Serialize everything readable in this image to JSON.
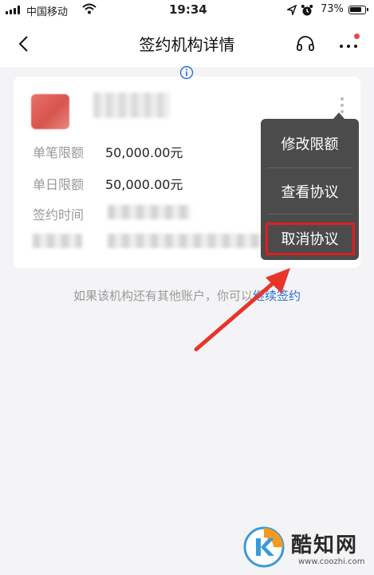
{
  "status_bar": {
    "carrier": "中国移动",
    "time": "19:34",
    "battery": "73%",
    "battery_level": 0.73,
    "icons": [
      "signal-icon",
      "wifi-icon",
      "location-icon",
      "alarm-icon",
      "battery-icon"
    ]
  },
  "nav": {
    "title": "签约机构详情",
    "icons": [
      "back-icon",
      "headset-icon",
      "more-icon"
    ],
    "badge_color": "#f04848"
  },
  "card": {
    "rows": [
      {
        "label": "单笔限额",
        "value": "50,000.00元"
      },
      {
        "label": "单日限额",
        "value": "50,000.00元"
      },
      {
        "label": "签约时间",
        "value": ""
      }
    ]
  },
  "menu": {
    "items": [
      {
        "label": "修改限额"
      },
      {
        "label": "查看协议"
      },
      {
        "label": "取消协议"
      }
    ],
    "highlight_color": "#e01e1e"
  },
  "hint": {
    "text": "如果该机构还有其他账户，你可以",
    "link": "继续签约",
    "link_color": "#2a6fd6"
  },
  "watermark": {
    "name": "酷知网",
    "url": "www.coozhi.com"
  }
}
